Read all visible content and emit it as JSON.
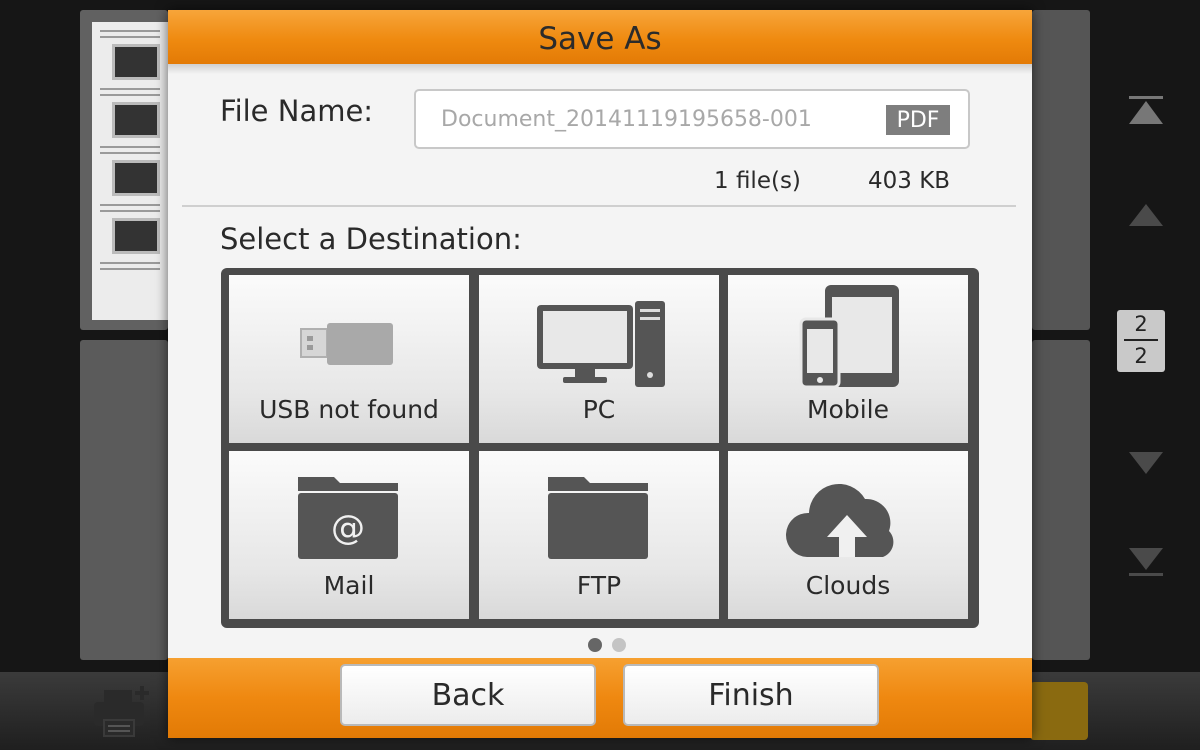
{
  "dialog": {
    "title": "Save As",
    "file_name_label": "File Name:",
    "file_name_value": "Document_20141119195658-001",
    "file_format": "PDF",
    "file_count": "1 file(s)",
    "file_size": "403 KB",
    "destination_label": "Select a Destination:",
    "destinations": [
      {
        "label": "USB not found",
        "icon": "usb-drive-icon",
        "enabled": false
      },
      {
        "label": "PC",
        "icon": "desktop-computer-icon",
        "enabled": true
      },
      {
        "label": "Mobile",
        "icon": "mobile-devices-icon",
        "enabled": true
      },
      {
        "label": "Mail",
        "icon": "mail-folder-icon",
        "enabled": true
      },
      {
        "label": "FTP",
        "icon": "folder-icon",
        "enabled": true
      },
      {
        "label": "Clouds",
        "icon": "cloud-upload-icon",
        "enabled": true
      }
    ],
    "pager": {
      "current": 1,
      "total": 2
    },
    "buttons": {
      "back": "Back",
      "finish": "Finish"
    }
  },
  "background": {
    "page_indicator": {
      "current": "2",
      "total": "2"
    }
  },
  "colors": {
    "accent_orange": "#ef8a10",
    "dialog_bg": "#f4f4f4",
    "tile_frame": "#4a4a4a",
    "icon_gray": "#555555",
    "dot_active": "#666666",
    "dot_inactive": "#c4c4c4"
  }
}
